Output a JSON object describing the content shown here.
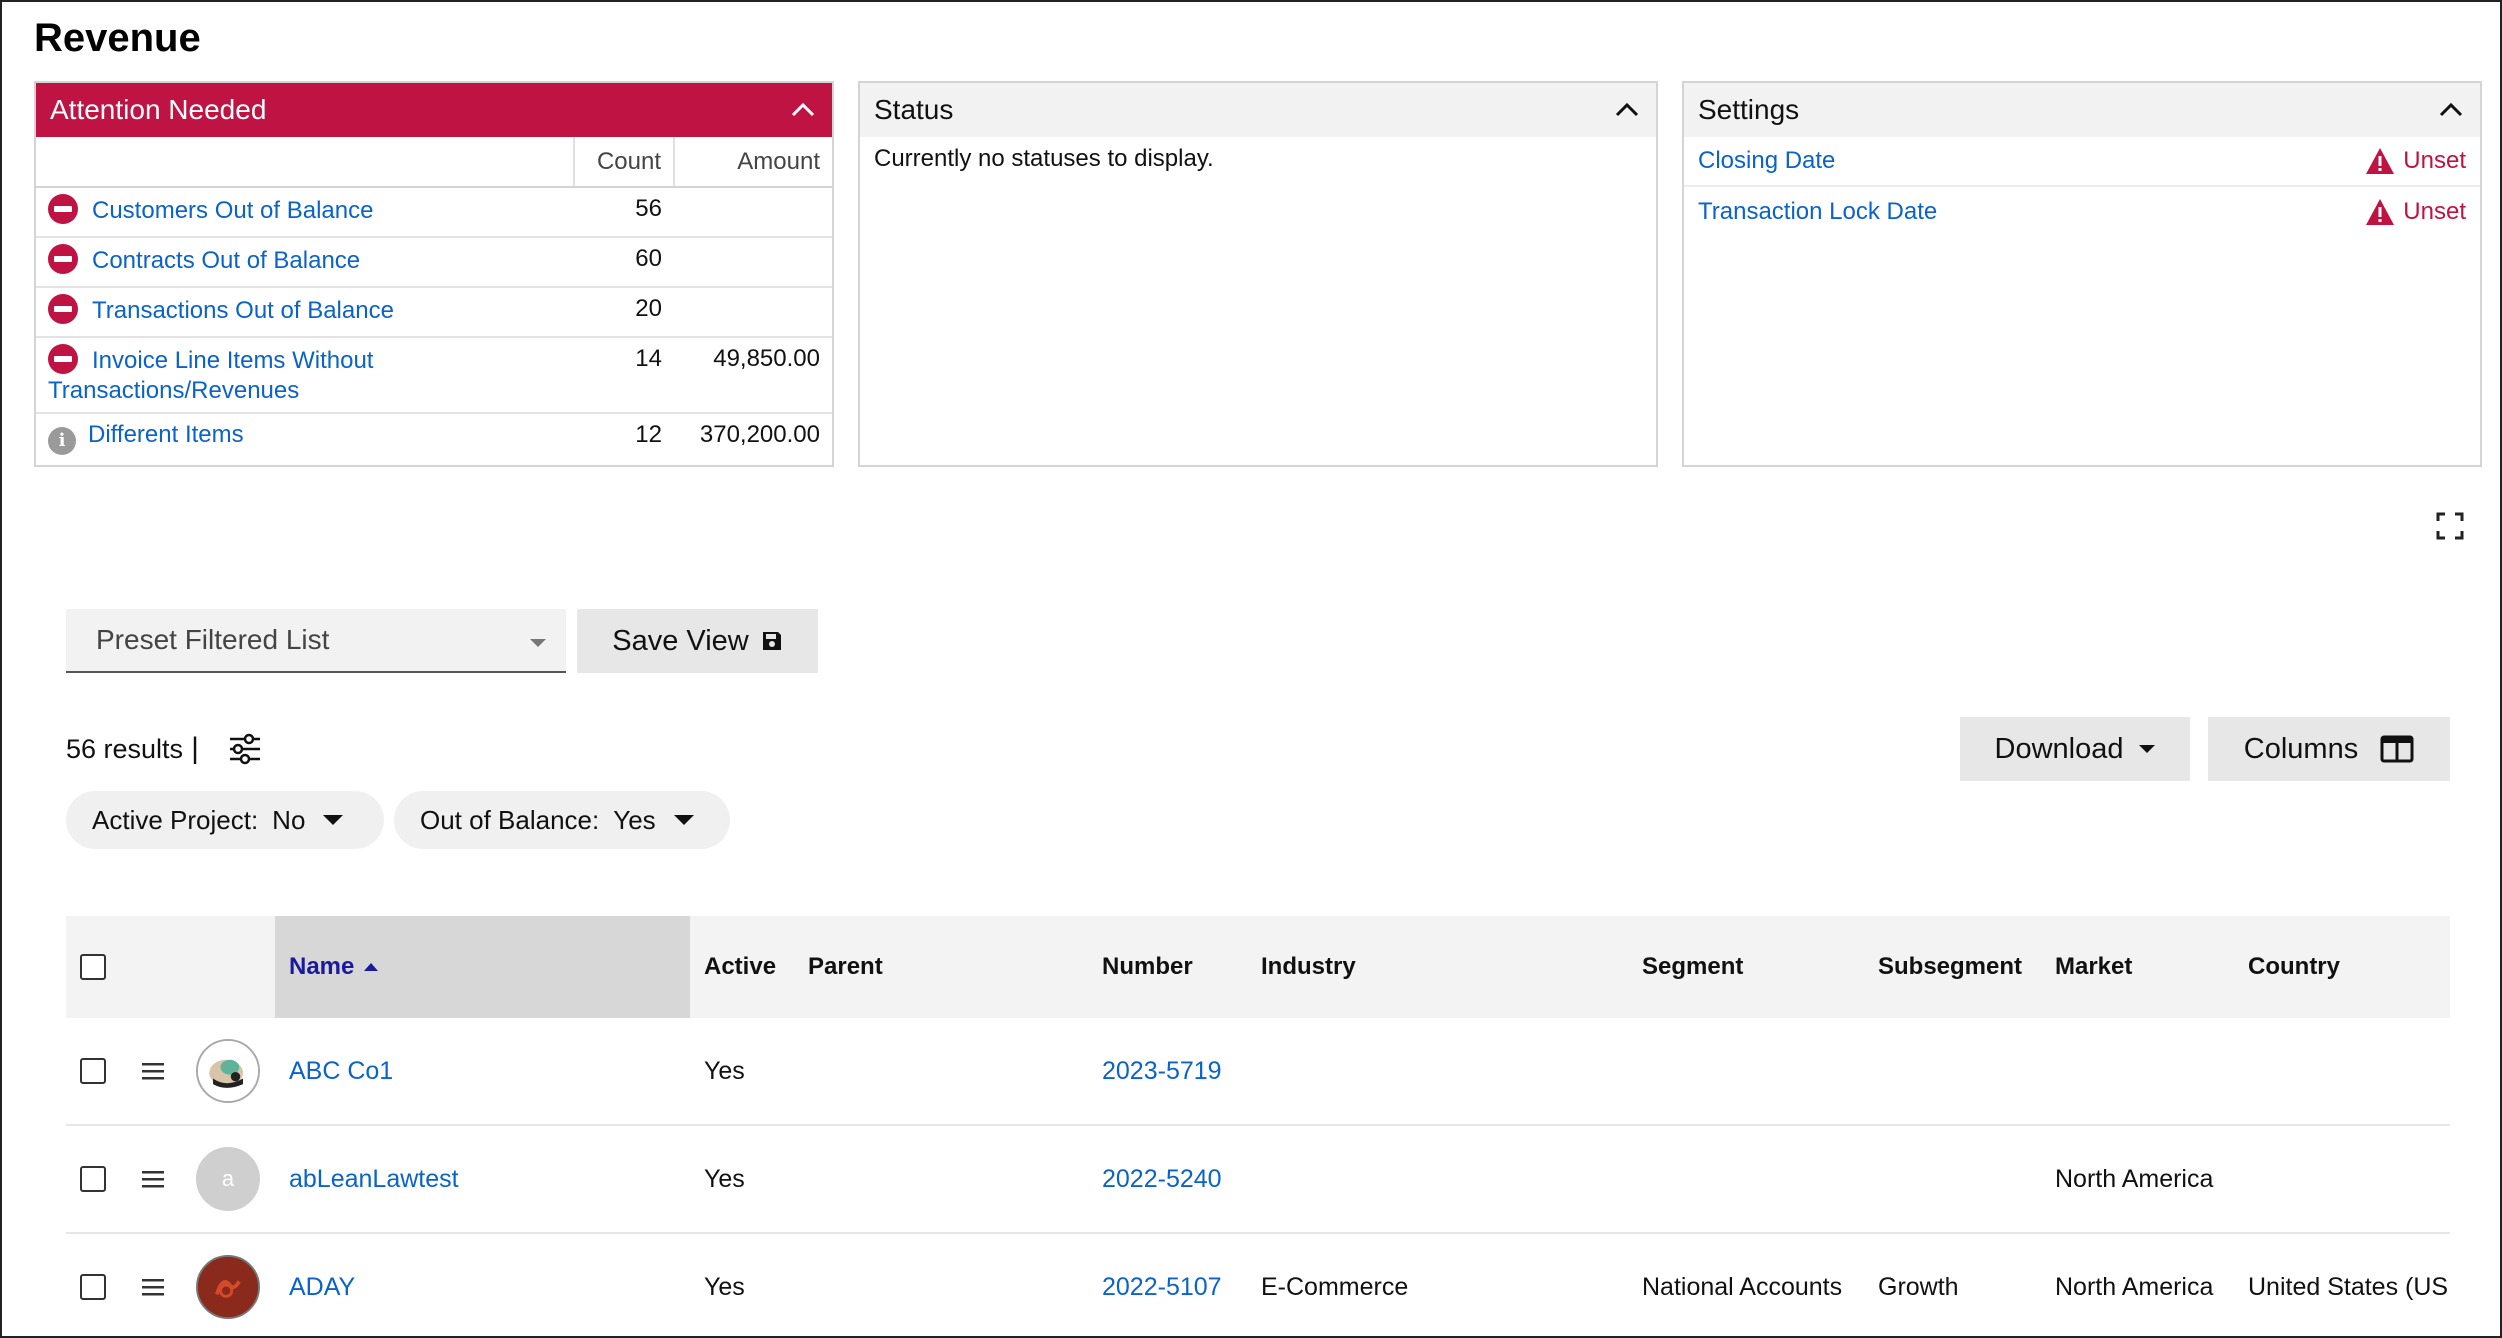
{
  "page": {
    "title": "Revenue"
  },
  "attention": {
    "title": "Attention Needed",
    "col_count": "Count",
    "col_amount": "Amount",
    "rows": [
      {
        "label": "Customers Out of Balance",
        "count": "56",
        "amount": "",
        "icon": "minus-circle-icon"
      },
      {
        "label": "Contracts Out of Balance",
        "count": "60",
        "amount": "",
        "icon": "minus-circle-icon"
      },
      {
        "label": "Transactions Out of Balance",
        "count": "20",
        "amount": "",
        "icon": "minus-circle-icon"
      },
      {
        "label": "Invoice Line Items Without Transactions/Revenues",
        "count": "14",
        "amount": "49,850.00",
        "icon": "minus-circle-icon"
      },
      {
        "label": "Different Items",
        "count": "12",
        "amount": "370,200.00",
        "icon": "info-icon"
      }
    ]
  },
  "status": {
    "title": "Status",
    "message": "Currently no statuses to display."
  },
  "settings": {
    "title": "Settings",
    "rows": [
      {
        "label": "Closing Date",
        "value": "Unset"
      },
      {
        "label": "Transaction Lock Date",
        "value": "Unset"
      }
    ]
  },
  "toolbar": {
    "preset_placeholder": "Preset Filtered List",
    "save_view": "Save View",
    "results": "56 results",
    "download": "Download",
    "columns": "Columns"
  },
  "filters": [
    {
      "label": "Active Project:",
      "value": "No"
    },
    {
      "label": "Out of Balance:",
      "value": "Yes"
    }
  ],
  "grid": {
    "headers": {
      "name": "Name",
      "active": "Active",
      "parent": "Parent",
      "number": "Number",
      "industry": "Industry",
      "segment": "Segment",
      "subsegment": "Subsegment",
      "market": "Market",
      "country": "Country"
    },
    "rows": [
      {
        "avatar": "photo",
        "name": "ABC Co1",
        "active": "Yes",
        "parent": "",
        "number": "2023-5719",
        "industry": "",
        "segment": "",
        "subsegment": "",
        "market": "",
        "country": ""
      },
      {
        "avatar": "a",
        "name": "abLeanLawtest",
        "active": "Yes",
        "parent": "",
        "number": "2022-5240",
        "industry": "",
        "segment": "",
        "subsegment": "",
        "market": "North America",
        "country": ""
      },
      {
        "avatar": "logo",
        "name": "ADAY",
        "active": "Yes",
        "parent": "",
        "number": "2022-5107",
        "industry": "E-Commerce",
        "segment": "National Accounts",
        "subsegment": "Growth",
        "market": "North America",
        "country": "United States (US"
      }
    ]
  },
  "colors": {
    "accent_red": "#bf1443",
    "link_blue": "#0a63c9",
    "header_grey": "#f2f2f2"
  }
}
